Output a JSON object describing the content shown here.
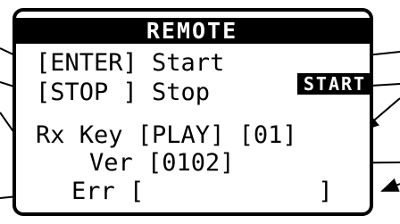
{
  "display": {
    "title": "REMOTE",
    "rows": [
      {
        "text": "[ENTER] Start"
      },
      {
        "text": "[STOP ] Stop"
      },
      {
        "text": "Rx Key [PLAY] [01]"
      },
      {
        "text": "Ver [0102]"
      },
      {
        "text": "Err [            ]"
      }
    ],
    "status_badge": "START"
  }
}
